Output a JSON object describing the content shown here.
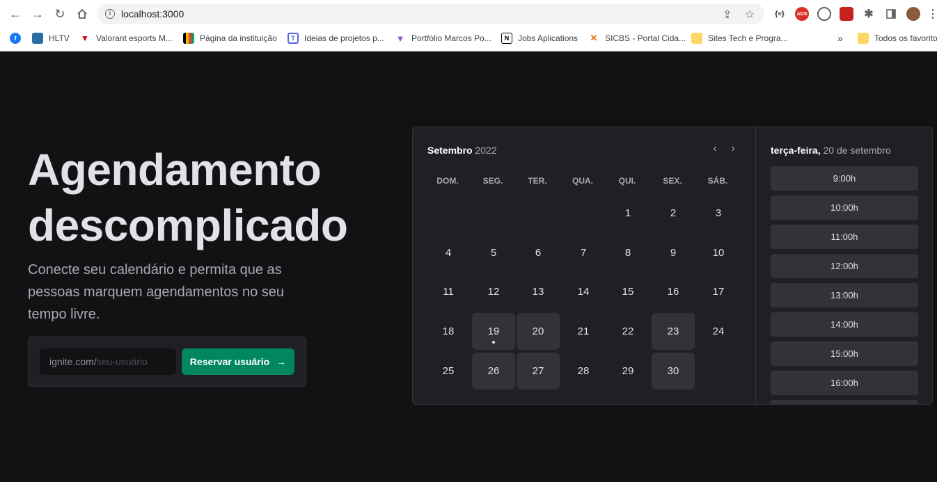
{
  "browser": {
    "url": "localhost:3000",
    "bookmarks": [
      {
        "label": ""
      },
      {
        "label": "HLTV"
      },
      {
        "label": "Valorant esports M..."
      },
      {
        "label": "Página da instituição"
      },
      {
        "label": "Ideias de projetos p..."
      },
      {
        "label": "Portfólio Marcos Po..."
      },
      {
        "label": "Jobs Aplications"
      },
      {
        "label": "SICBS - Portal Cida..."
      },
      {
        "label": "Sites Tech e Progra..."
      }
    ],
    "bookmarks_overflow": "»",
    "all_bookmarks": "Todos os favoritos",
    "extensions": {
      "devtools": "{≡}",
      "ads": "ADS"
    }
  },
  "hero": {
    "title_line1": "Agendamento",
    "title_line2": "descomplicado",
    "subtitle": "Conecte seu calendário e permita que as pessoas marquem agendamentos no seu tempo livre.",
    "input_prefix": "ignite.com/",
    "input_placeholder": "seu-usuário",
    "button_label": "Reservar usuário",
    "button_arrow": "→"
  },
  "calendar": {
    "month": "Setembro",
    "year": "2022",
    "prev": "‹",
    "next": "›",
    "weekdays": [
      "DOM.",
      "SEG.",
      "TER.",
      "QUA.",
      "QUI.",
      "SEX.",
      "SÁB."
    ],
    "weeks": [
      [
        null,
        null,
        null,
        null,
        {
          "d": "1"
        },
        {
          "d": "2"
        },
        {
          "d": "3"
        }
      ],
      [
        {
          "d": "4"
        },
        {
          "d": "5"
        },
        {
          "d": "6"
        },
        {
          "d": "7"
        },
        {
          "d": "8"
        },
        {
          "d": "9"
        },
        {
          "d": "10"
        }
      ],
      [
        {
          "d": "11"
        },
        {
          "d": "12"
        },
        {
          "d": "13"
        },
        {
          "d": "14"
        },
        {
          "d": "15"
        },
        {
          "d": "16"
        },
        {
          "d": "17"
        }
      ],
      [
        {
          "d": "18"
        },
        {
          "d": "19",
          "avail": true,
          "today": true
        },
        {
          "d": "20",
          "avail": true
        },
        {
          "d": "21"
        },
        {
          "d": "22"
        },
        {
          "d": "23",
          "avail": true
        },
        {
          "d": "24"
        }
      ],
      [
        {
          "d": "25"
        },
        {
          "d": "26",
          "avail": true
        },
        {
          "d": "27",
          "avail": true
        },
        {
          "d": "28"
        },
        {
          "d": "29"
        },
        {
          "d": "30",
          "avail": true
        },
        null
      ]
    ],
    "selected_weekday": "terça-feira,",
    "selected_date": " 20 de setembro",
    "slots": [
      "9:00h",
      "10:00h",
      "11:00h",
      "12:00h",
      "13:00h",
      "14:00h",
      "15:00h",
      "16:00h",
      ""
    ]
  }
}
